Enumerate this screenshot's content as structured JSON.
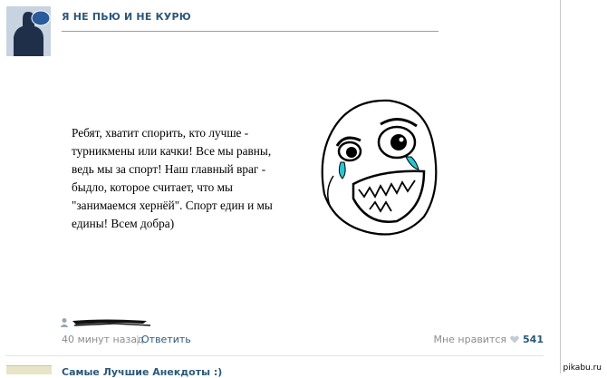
{
  "post": {
    "author": "Я НЕ ПЬЮ И НЕ КУРЮ",
    "avatar_icon": "group-avatar-icon",
    "content_text": "Ребят, хватит спорить, кто лучше -\nтурникмены или качки! Все мы равны,\nведь мы за спорт! Наш главный враг -\nбыдло, которое считает, что мы\n\"занимаемся хернёй\". Спорт един и мы\nедины! Всем добра)",
    "image_icon": "rage-face-happy-tears-icon"
  },
  "meta": {
    "time": "40 минут назад",
    "separator": "|",
    "reply_label": "Ответить",
    "like_label": "Мне нравится",
    "like_count": "541",
    "like_icon": "heart-icon"
  },
  "next_post": {
    "title": "Самые Лучшие Анекдоты :)"
  },
  "watermark": "pikabu.ru",
  "colors": {
    "link": "#2b587a",
    "muted": "#8c8c8c"
  }
}
